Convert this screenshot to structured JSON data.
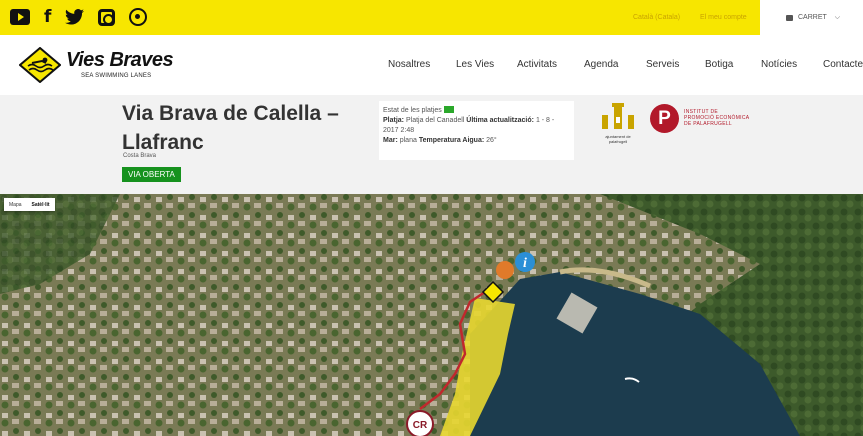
{
  "topbar": {
    "social": [
      "youtube-icon",
      "facebook-icon",
      "twitter-icon",
      "instagram-icon",
      "whatsapp-icon"
    ],
    "facebook_glyph": "f",
    "language": "Català (Catala)",
    "account": "El meu compte",
    "cart": "CARRET",
    "cart_chevron": "⌵"
  },
  "brand": {
    "name": "Vies Braves",
    "tagline": "SEA SWIMMING LANES"
  },
  "menu": [
    "Nosaltres",
    "Les Vies",
    "Activitats",
    "Agenda",
    "Serveis",
    "Botiga",
    "Notícies",
    "Contacte"
  ],
  "header": {
    "title": "Via Brava de Calella – Llafranc",
    "region": "Costa Brava",
    "status": "VIA OBERTA",
    "beach_status_label": "Estat de les platjes",
    "beach_label": "Platja:",
    "beach_value": "Platja del Canadell",
    "update_label": "Última actualització:",
    "update_value": "1 - 8 - 2017 2:48",
    "sea_label": "Mar:",
    "sea_value": "plana",
    "temp_label": "Temperatura Aigua:",
    "temp_value": "26°",
    "ajuntament": "ajuntament de palafrugell",
    "promo_letter": "P",
    "promo_line1": "INSTITUT DE",
    "promo_line2": "PROMOCIÓ ECONÒMICA",
    "promo_line3": "DE PALAFRUGELL"
  },
  "map": {
    "type_map": "Mapa",
    "type_satellite": "Satèl·lit",
    "marker_info": "i",
    "marker_cr": "CR"
  },
  "colors": {
    "topbar": "#f7e600",
    "status_green": "#16921e",
    "promo_red": "#b2192a",
    "route_red": "#c0282d",
    "zone_yellow": "#e8d730",
    "sea": "#1c3c4e"
  }
}
